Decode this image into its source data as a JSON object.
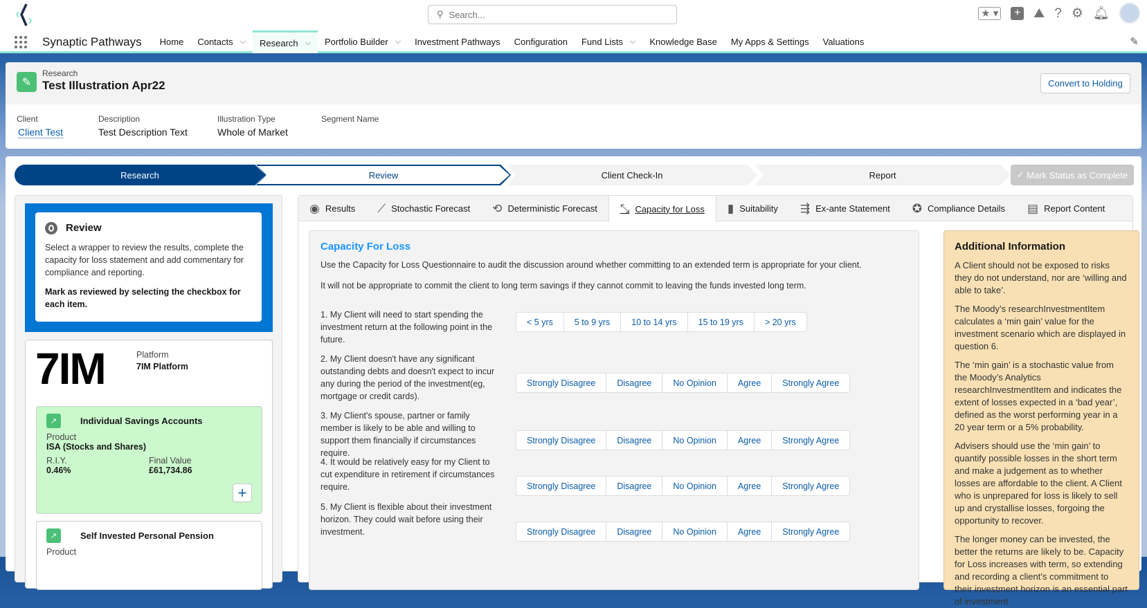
{
  "app": {
    "name": "Synaptic Pathways",
    "search_placeholder": "Search..."
  },
  "nav": [
    {
      "label": "Home"
    },
    {
      "label": "Contacts",
      "menu": true
    },
    {
      "label": "Research",
      "menu": true,
      "active": true
    },
    {
      "label": "Portfolio Builder",
      "menu": true
    },
    {
      "label": "Investment Pathways"
    },
    {
      "label": "Configuration"
    },
    {
      "label": "Fund Lists",
      "menu": true
    },
    {
      "label": "Knowledge Base"
    },
    {
      "label": "My Apps & Settings"
    },
    {
      "label": "Valuations"
    }
  ],
  "record": {
    "object": "Research",
    "title": "Test Illustration Apr22",
    "convert_label": "Convert to Holding",
    "fields": [
      {
        "label": "Client",
        "value": "Client Test"
      },
      {
        "label": "Description",
        "value": "Test Description Text"
      },
      {
        "label": "Illustration Type",
        "value": "Whole of Market"
      },
      {
        "label": "Segment Name",
        "value": ""
      }
    ]
  },
  "path": {
    "stages": [
      "Research",
      "Review",
      "Client Check-In",
      "Report"
    ],
    "mark_label": "Mark Status as Complete"
  },
  "review": {
    "title": "Review",
    "text": "Select a wrapper to review the results, complete the capacity for loss statement and add commentary for compliance and reporting.",
    "bold": "Mark as reviewed by selecting the checkbox for each item."
  },
  "platform": {
    "logo": "7IM",
    "label": "Platform",
    "value": "7IM Platform"
  },
  "wrappers": [
    {
      "title": "Individual Savings Accounts",
      "product_label": "Product",
      "product": "ISA (Stocks and Shares)",
      "riy_label": "R.I.Y.",
      "riy": "0.46%",
      "fv_label": "Final Value",
      "fv": "£61,734.86"
    },
    {
      "title": "Self Invested Personal Pension",
      "product_label": "Product"
    }
  ],
  "tabs": [
    "Results",
    "Stochastic Forecast",
    "Deterministic Forecast",
    "Capacity for Loss",
    "Suitability",
    "Ex-ante Statement",
    "Compliance Details",
    "Report Content"
  ],
  "cfl": {
    "title": "Capacity For Loss",
    "intro1": "Use the Capacity for Loss Questionnaire to audit the discussion around whether committing to an extended term is appropriate for your client.",
    "intro2": "It will not be appropriate to commit the client to long term savings if they cannot commit to leaving the funds invested long term.",
    "questions": [
      {
        "text": "1. My Client will need to start spending the investment return at the following point in the future.",
        "options": [
          "< 5 yrs",
          "5 to 9 yrs",
          "10 to 14 yrs",
          "15 to 19 yrs",
          "> 20 yrs"
        ]
      },
      {
        "text": "2. My Client doesn't have any significant outstanding debts and doesn't expect to incur any during the period of the investment(eg, mortgage or credit cards).",
        "options": [
          "Strongly Disagree",
          "Disagree",
          "No Opinion",
          "Agree",
          "Strongly Agree"
        ]
      },
      {
        "text": "3. My Client's spouse, partner or family member is likely to be able and willing to support them financially if circumstances require.",
        "options": [
          "Strongly Disagree",
          "Disagree",
          "No Opinion",
          "Agree",
          "Strongly Agree"
        ]
      },
      {
        "text": "4. It would be relatively easy for my Client to cut expenditure in retirement if circumstances require.",
        "options": [
          "Strongly Disagree",
          "Disagree",
          "No Opinion",
          "Agree",
          "Strongly Agree"
        ]
      },
      {
        "text": "5. My Client is flexible about their investment horizon. They could wait before using their investment.",
        "options": [
          "Strongly Disagree",
          "Disagree",
          "No Opinion",
          "Agree",
          "Strongly Agree"
        ]
      }
    ]
  },
  "additional": {
    "title": "Additional Information",
    "paras": [
      "A Client should not be exposed to risks they do not understand, nor are ‘willing and able to take’.",
      "The Moody’s researchInvestmentItem calculates a ‘min gain’ value for the investment scenario which are displayed in question 6.",
      "The ‘min gain’ is a stochastic value from the Moody’s Analytics researchInvestmentItem and indicates the extent of losses expected in a ‘bad year’, defined as the worst performing year in a 20 year term or a 5% probability.",
      "Advisers should use the ‘min gain’ to quantify possible losses in the short term and make a judgement as to whether losses are affordable to the client. A Client who is unprepared for loss is likely to sell up and crystallise losses, forgoing the opportunity to recover.",
      "The longer money can be invested, the better the returns are likely to be. Capacity for Loss increases with term, so extending and recording a client’s commitment to their investment horizon is an essential part of investment"
    ]
  }
}
